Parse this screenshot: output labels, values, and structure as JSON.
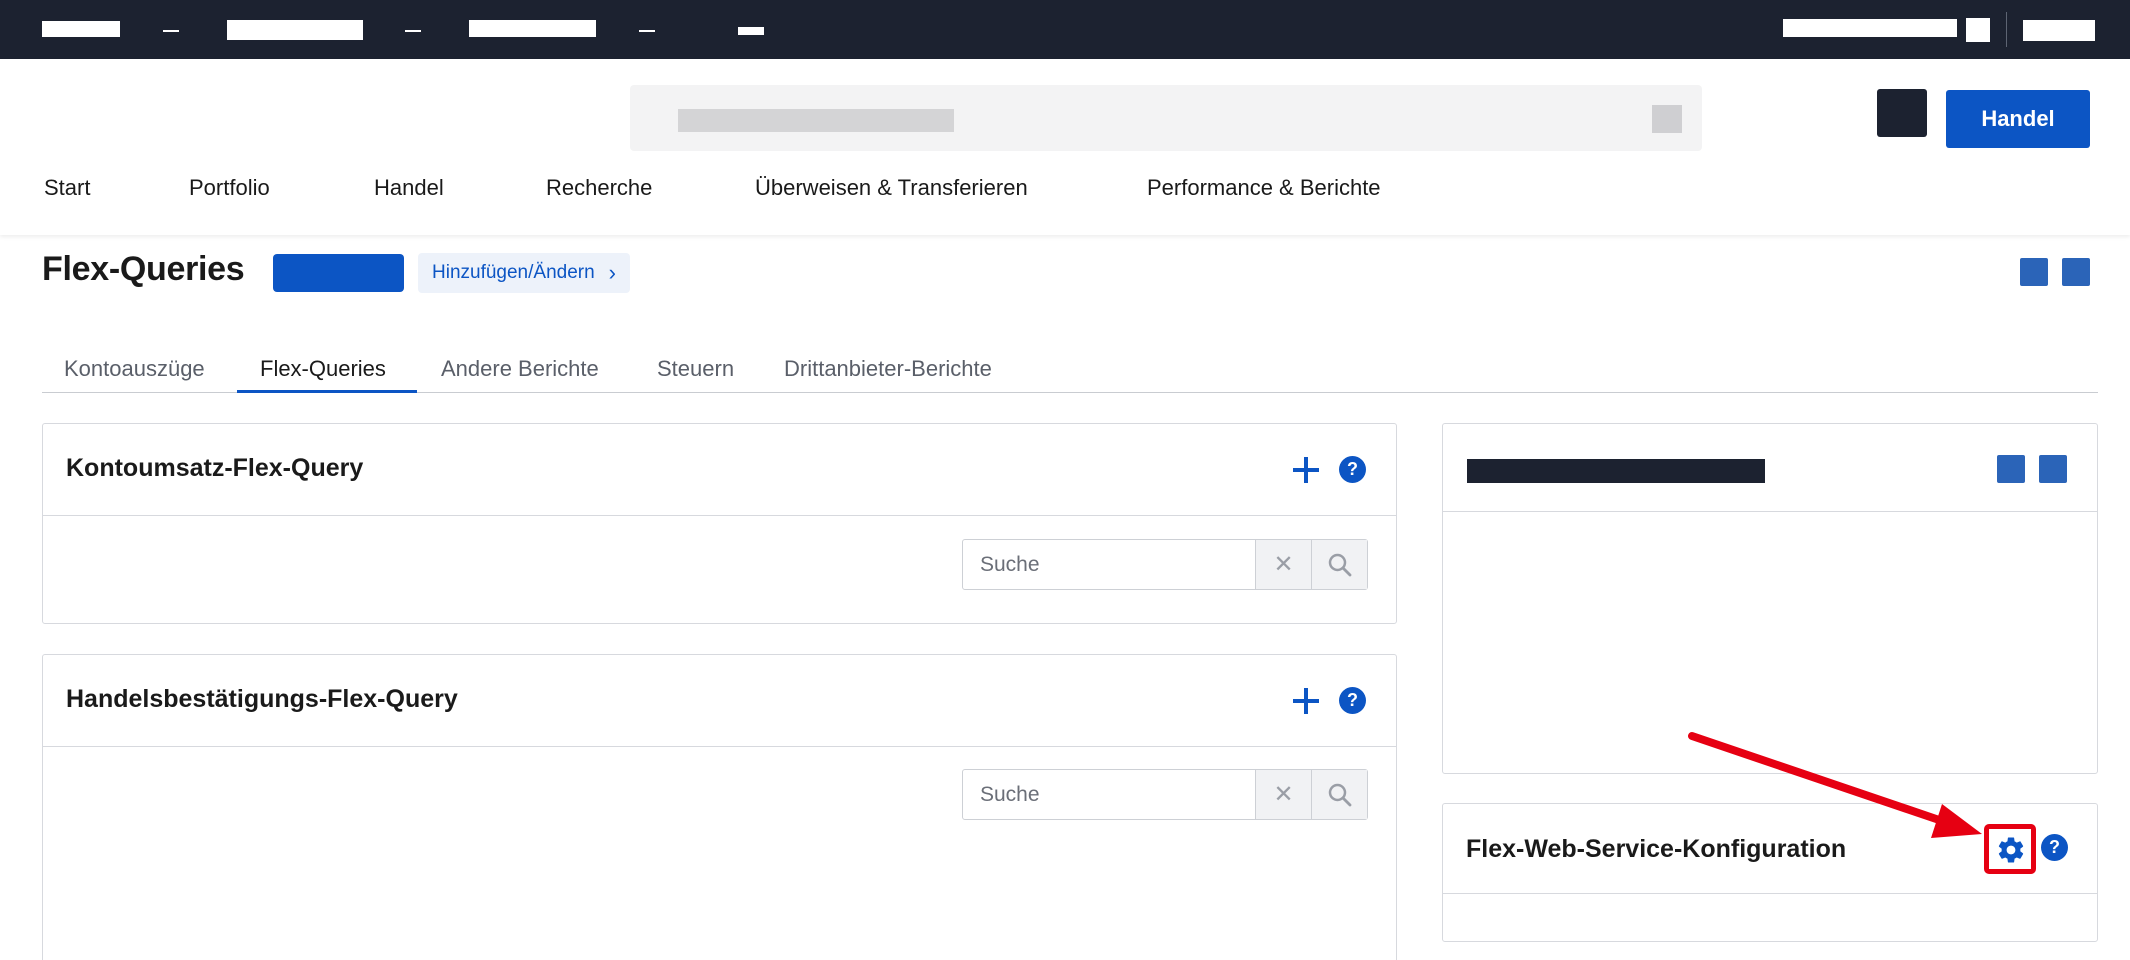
{
  "header": {
    "trade_button": "Handel",
    "nav_items": [
      "Start",
      "Portfolio",
      "Handel",
      "Recherche",
      "Überweisen & Transferieren",
      "Performance & Berichte"
    ]
  },
  "page": {
    "title": "Flex-Queries",
    "add_change_link": "Hinzufügen/Ändern",
    "add_change_chevron": "›"
  },
  "tabs": [
    "Kontoauszüge",
    "Flex-Queries",
    "Andere Berichte",
    "Steuern",
    "Drittanbieter-Berichte"
  ],
  "active_tab": "Flex-Queries",
  "panels": {
    "activity": {
      "title": "Kontoumsatz-Flex-Query",
      "search_placeholder": "Suche"
    },
    "trade_confirmation": {
      "title": "Handelsbestätigungs-Flex-Query",
      "search_placeholder": "Suche"
    },
    "web_service": {
      "title": "Flex-Web-Service-Konfiguration"
    }
  },
  "glyphs": {
    "clear": "✕",
    "help": "?"
  },
  "colors": {
    "accent": "#0c55c4",
    "topbar": "#1c2230",
    "annotation": "#e60012"
  },
  "icons": [
    "plus-icon",
    "help-icon",
    "clear-icon",
    "search-icon",
    "gear-icon",
    "chevron-right-icon"
  ]
}
